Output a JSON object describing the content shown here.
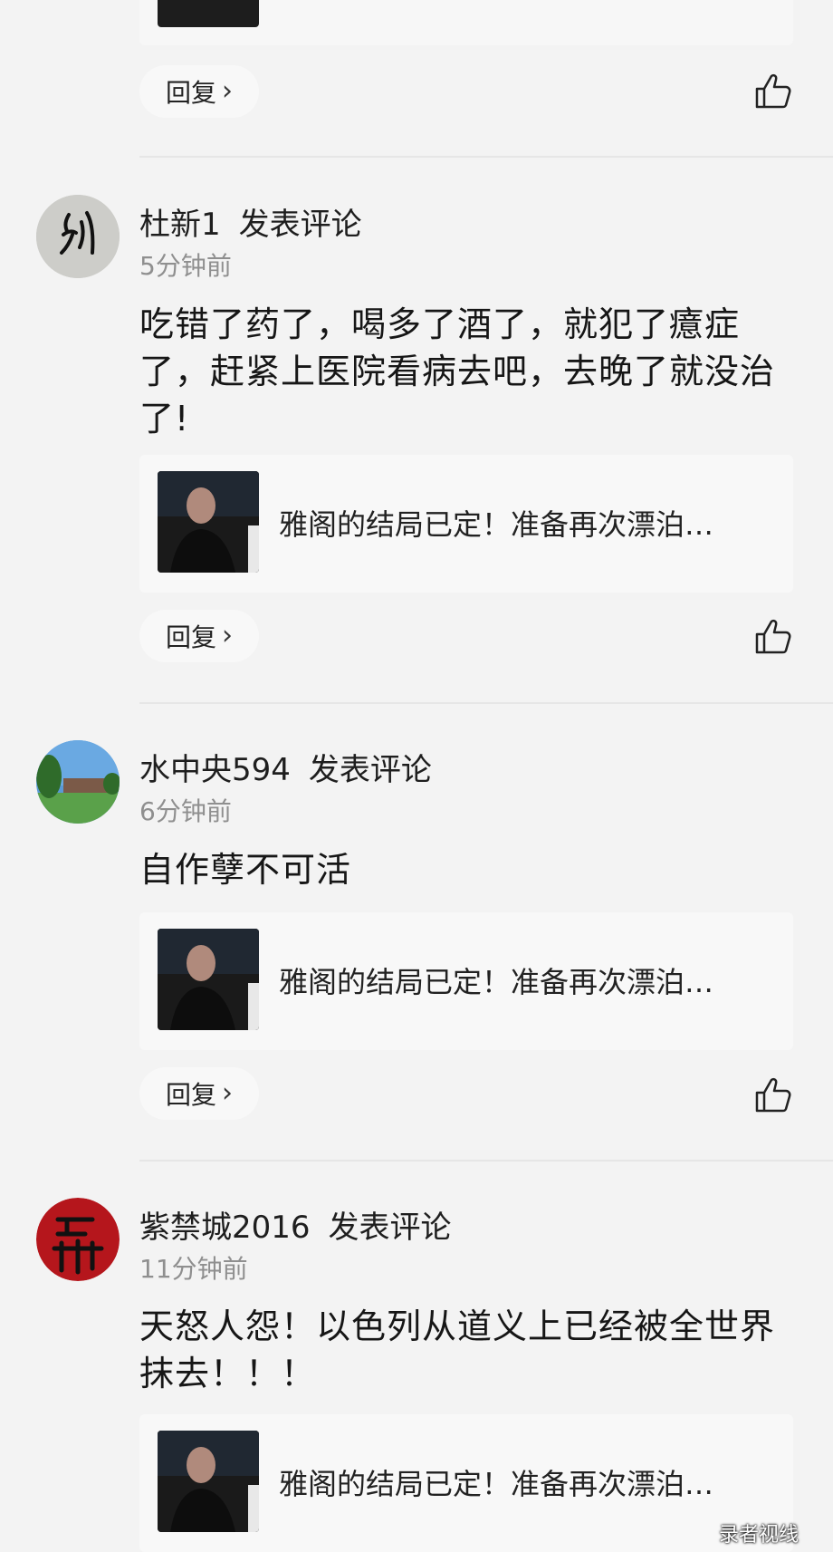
{
  "reply_label": "回复",
  "accent": "#222222",
  "icons": {
    "reply_chevron": "chevron-right",
    "like": "thumbs-up"
  },
  "comments": [
    {
      "username": "杜新1",
      "action": "发表评论",
      "time": "5分钟前",
      "text": "吃错了药了，喝多了酒了，就犯了癔症了，赶紧上医院看病去吧，去晚了就没治了!",
      "article_title": "雅阁的结局已定！准备再次漂泊…"
    },
    {
      "username": "水中央594",
      "action": "发表评论",
      "time": "6分钟前",
      "text": "自作孽不可活",
      "article_title": "雅阁的结局已定！准备再次漂泊…"
    },
    {
      "username": "紫禁城2016",
      "action": "发表评论",
      "time": "11分钟前",
      "text": "天怒人怨！以色列从道义上已经被全世界抹去！！！",
      "article_title": "雅阁的结局已定！准备再次漂泊…"
    }
  ],
  "watermark": "录者视线"
}
